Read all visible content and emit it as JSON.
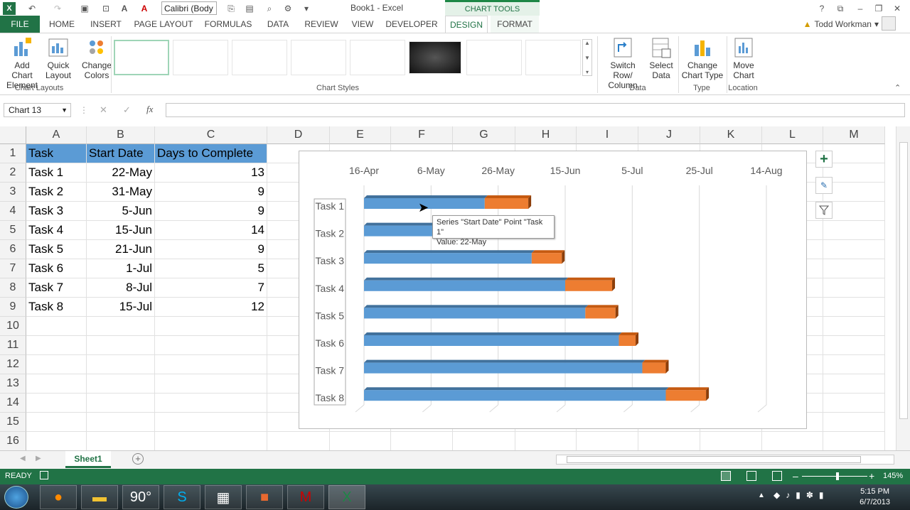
{
  "titlebar": {
    "font_value": "Calibri (Body",
    "book_title": "Book1 - Excel",
    "chart_tools": "CHART TOOLS",
    "help": "?"
  },
  "tabs": [
    "FILE",
    "HOME",
    "INSERT",
    "PAGE LAYOUT",
    "FORMULAS",
    "DATA",
    "REVIEW",
    "VIEW",
    "DEVELOPER",
    "DESIGN",
    "FORMAT"
  ],
  "user": {
    "name": "Todd Workman"
  },
  "ribbon": {
    "add_chart_element": [
      "Add Chart",
      "Element"
    ],
    "quick_layout": [
      "Quick",
      "Layout"
    ],
    "change_colors": [
      "Change",
      "Colors"
    ],
    "chart_layouts_label": "Chart Layouts",
    "chart_styles_label": "Chart Styles",
    "switch_row_col": [
      "Switch Row/",
      "Column"
    ],
    "select_data": [
      "Select",
      "Data"
    ],
    "data_label": "Data",
    "change_chart_type": [
      "Change",
      "Chart Type"
    ],
    "type_label": "Type",
    "move_chart": [
      "Move",
      "Chart"
    ],
    "location_label": "Location"
  },
  "namebox": "Chart 13",
  "columns": [
    "A",
    "B",
    "C",
    "D",
    "E",
    "F",
    "G",
    "H",
    "I",
    "J",
    "K",
    "L",
    "M"
  ],
  "rows": [
    "1",
    "2",
    "3",
    "4",
    "5",
    "6",
    "7",
    "8",
    "9",
    "10",
    "11",
    "12",
    "13",
    "14",
    "15",
    "16"
  ],
  "table": {
    "headers": [
      "Task",
      "Start Date",
      "Days to Complete"
    ],
    "rows": [
      [
        "Task 1",
        "22-May",
        "13"
      ],
      [
        "Task 2",
        "31-May",
        "9"
      ],
      [
        "Task 3",
        "5-Jun",
        "9"
      ],
      [
        "Task 4",
        "15-Jun",
        "14"
      ],
      [
        "Task 5",
        "21-Jun",
        "9"
      ],
      [
        "Task 6",
        "1-Jul",
        "5"
      ],
      [
        "Task 7",
        "8-Jul",
        "7"
      ],
      [
        "Task 8",
        "15-Jul",
        "12"
      ]
    ]
  },
  "chart_data": {
    "type": "bar",
    "orientation": "horizontal-stacked",
    "categories": [
      "Task 1",
      "Task 2",
      "Task 3",
      "Task 4",
      "Task 5",
      "Task 6",
      "Task 7",
      "Task 8"
    ],
    "x_ticks": [
      "16-Apr",
      "6-May",
      "26-May",
      "15-Jun",
      "5-Jul",
      "25-Jul",
      "14-Aug"
    ],
    "series": [
      {
        "values": [
          "22-May",
          "31-May",
          "5-Jun",
          "15-Jun",
          "21-Jun",
          "1-Jul",
          "8-Jul",
          "15-Jul"
        ],
        "color": "#5b9bd5"
      },
      {
        "values": [
          13,
          9,
          9,
          14,
          9,
          5,
          7,
          12
        ],
        "color": "#ed7d31"
      }
    ],
    "legend": "none",
    "grid": true
  },
  "tooltip": {
    "line1": "Series \"Start Date\" Point \"Task 1\"",
    "line2": "Value: 22-May"
  },
  "sheet": {
    "tab": "Sheet1"
  },
  "status": {
    "ready": "READY",
    "zoom": "145%"
  },
  "taskbar": {
    "temp": "90°",
    "time": "5:15 PM",
    "date": "6/7/2013"
  },
  "colors": {
    "excel_green": "#217346",
    "header_fill": "#5b9bd5"
  }
}
